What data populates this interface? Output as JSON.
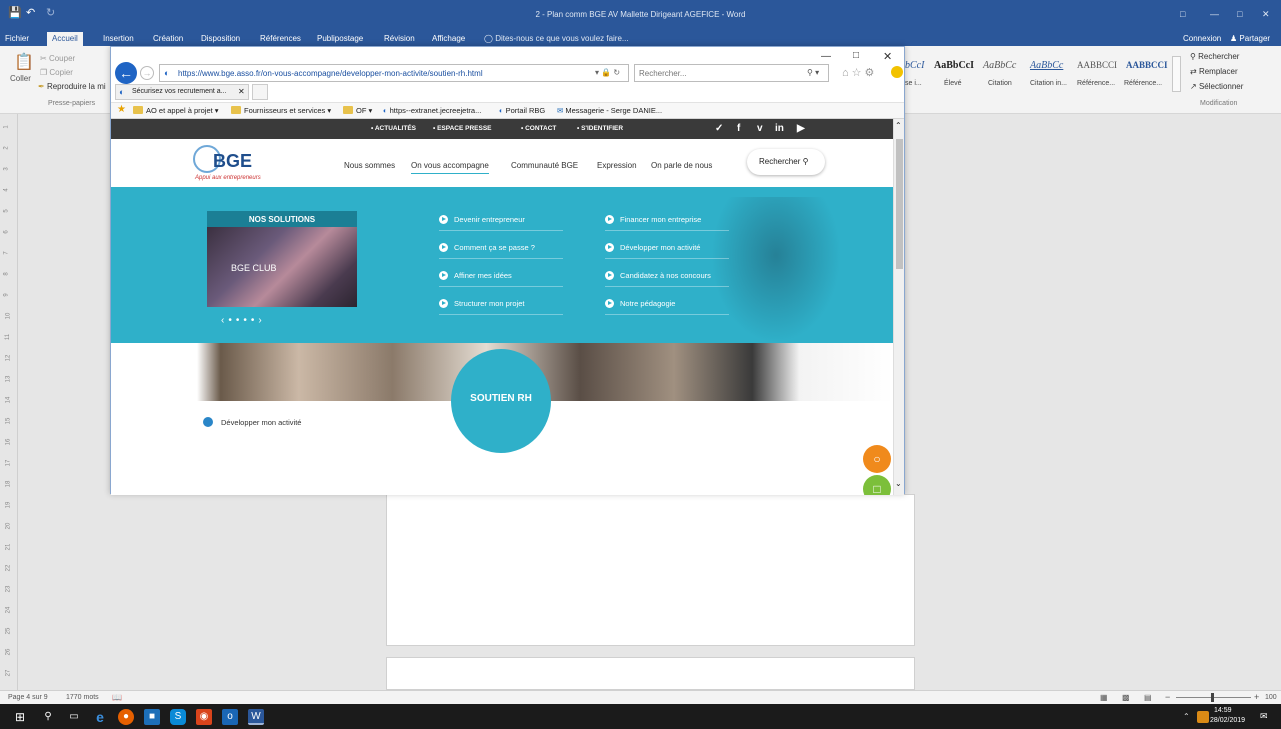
{
  "word": {
    "title": "2 - Plan comm BGE AV Mallette Dirigeant AGEFICE - Word",
    "menu_tabs": [
      "Fichier",
      "Accueil",
      "Insertion",
      "Création",
      "Disposition",
      "Références",
      "Publipostage",
      "Révision",
      "Affichage"
    ],
    "tell_me": "Dites-nous ce que vous voulez faire...",
    "connexion": "Connexion",
    "share": "Partager",
    "clipboard": {
      "paste": "Coller",
      "cut": "Couper",
      "copy": "Copier",
      "format_painter": "Reproduire la mi",
      "group": "Presse-papiers"
    },
    "styles": [
      {
        "sample": "bCcI",
        "label": "se i..."
      },
      {
        "sample": "AaBbCcI",
        "label": "Élevé"
      },
      {
        "sample": "AaBbCc",
        "label": "Citation"
      },
      {
        "sample": "AaBbCc",
        "label": "Citation in..."
      },
      {
        "sample": "AABBCCI",
        "label": "Référence..."
      },
      {
        "sample": "AABBCCI",
        "label": "Référence..."
      }
    ],
    "editing": {
      "find": "Rechercher",
      "replace": "Remplacer",
      "select": "Sélectionner",
      "group": "Modification"
    },
    "ruler_numbers": [
      "1",
      "2",
      "3",
      "4",
      "5",
      "6",
      "7",
      "8",
      "9",
      "10",
      "11",
      "12",
      "13",
      "14",
      "15",
      "16",
      "17",
      "18",
      "19",
      "20",
      "21",
      "22",
      "23",
      "24",
      "25",
      "26",
      "27"
    ],
    "status": {
      "page": "Page 4 sur 9",
      "words": "1770 mots",
      "zoom": "100"
    }
  },
  "browser": {
    "url": "https://www.bge.asso.fr/on-vous-accompagne/developper-mon-activite/soutien-rh.html",
    "search_placeholder": "Rechercher...",
    "tab_title": "Sécurisez vos recrutement a...",
    "favorites": [
      {
        "label": "AO et appel à projet ▾",
        "kind": "folder"
      },
      {
        "label": "Fournisseurs et services ▾",
        "kind": "folder"
      },
      {
        "label": "OF ▾",
        "kind": "folder"
      },
      {
        "label": "https--extranet.jecreejetra...",
        "kind": "page"
      },
      {
        "label": "Portail RBG",
        "kind": "page"
      },
      {
        "label": "Messagerie - Serge DANIE...",
        "kind": "mail"
      }
    ]
  },
  "site": {
    "top_links": [
      "• ACTUALITÉS",
      "• ESPACE PRESSE",
      "• CONTACT",
      "• S'IDENTIFIER"
    ],
    "logo_text": "BGE",
    "logo_sub": "Appui aux entrepreneurs",
    "nav": [
      "Nous sommes",
      "On vous accompagne",
      "Communauté BGE",
      "Expression",
      "On parle de nous"
    ],
    "search_label": "Rechercher",
    "solutions_title": "NOS SOLUTIONS",
    "slide_caption": "BGE CLUB",
    "links_left": [
      "Devenir entrepreneur",
      "Comment ça se passe ?",
      "Affiner mes idées",
      "Structurer mon projet"
    ],
    "links_right": [
      "Financer mon entreprise",
      "Développer mon activité",
      "Candidatez à nos concours",
      "Notre pédagogie"
    ],
    "section_title": "SOUTIEN RH",
    "breadcrumb": "Développer mon activité"
  },
  "taskbar": {
    "time": "14:59",
    "date": "28/02/2019"
  },
  "colors": {
    "word_blue": "#2b579a",
    "bge_teal": "#2fb0c9",
    "site_dark": "#3a3a3a"
  }
}
